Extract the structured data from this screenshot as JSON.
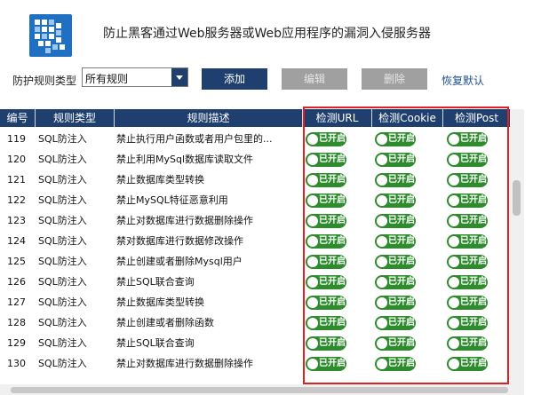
{
  "header": {
    "title": "防止黑客通过Web服务器或Web应用程序的漏洞入侵服务器",
    "logo_icon": "shield-grid-icon",
    "logo_color": "#1f6fc2"
  },
  "toolbar": {
    "filter_label": "防护规则类型",
    "filter_value": "所有规则",
    "add_label": "添加",
    "edit_label": "编辑",
    "delete_label": "删除",
    "reset_label": "恢复默认"
  },
  "table": {
    "columns": [
      "编号",
      "规则类型",
      "规则描述",
      "检测URL",
      "检测Cookie",
      "检测Post"
    ],
    "rows": [
      {
        "id": "119",
        "type": "SQL防注入",
        "desc": "禁止执行用户函数或者用户包里的...",
        "url": "已开启",
        "cookie": "已开启",
        "post": "已开启"
      },
      {
        "id": "120",
        "type": "SQL防注入",
        "desc": "禁止利用MySql数据库读取文件",
        "url": "已开启",
        "cookie": "已开启",
        "post": "已开启"
      },
      {
        "id": "121",
        "type": "SQL防注入",
        "desc": "禁止数据库类型转换",
        "url": "已开启",
        "cookie": "已开启",
        "post": "已开启"
      },
      {
        "id": "122",
        "type": "SQL防注入",
        "desc": "禁止MySQL特征恶意利用",
        "url": "已开启",
        "cookie": "已开启",
        "post": "已开启"
      },
      {
        "id": "123",
        "type": "SQL防注入",
        "desc": "禁止对数据库进行数据删除操作",
        "url": "已开启",
        "cookie": "已开启",
        "post": "已开启"
      },
      {
        "id": "124",
        "type": "SQL防注入",
        "desc": "禁对数据库进行数据修改操作",
        "url": "已开启",
        "cookie": "已开启",
        "post": "已开启"
      },
      {
        "id": "125",
        "type": "SQL防注入",
        "desc": "禁止创建或者删除Mysql用户",
        "url": "已开启",
        "cookie": "已开启",
        "post": "已开启"
      },
      {
        "id": "126",
        "type": "SQL防注入",
        "desc": "禁止SQL联合查询",
        "url": "已开启",
        "cookie": "已开启",
        "post": "已开启"
      },
      {
        "id": "127",
        "type": "SQL防注入",
        "desc": "禁止数据库类型转换",
        "url": "已开启",
        "cookie": "已开启",
        "post": "已开启"
      },
      {
        "id": "128",
        "type": "SQL防注入",
        "desc": "禁止创建或者删除函数",
        "url": "已开启",
        "cookie": "已开启",
        "post": "已开启"
      },
      {
        "id": "129",
        "type": "SQL防注入",
        "desc": "禁止SQL联合查询",
        "url": "已开启",
        "cookie": "已开启",
        "post": "已开启"
      },
      {
        "id": "130",
        "type": "SQL防注入",
        "desc": "禁止对数据库进行数据删除操作",
        "url": "已开启",
        "cookie": "已开启",
        "post": "已开启"
      }
    ]
  },
  "colors": {
    "header_bg": "#1f3f6e",
    "toggle_on": "#2e8b2e",
    "highlight_border": "#e02020",
    "disabled_button": "#a0a0a0"
  }
}
